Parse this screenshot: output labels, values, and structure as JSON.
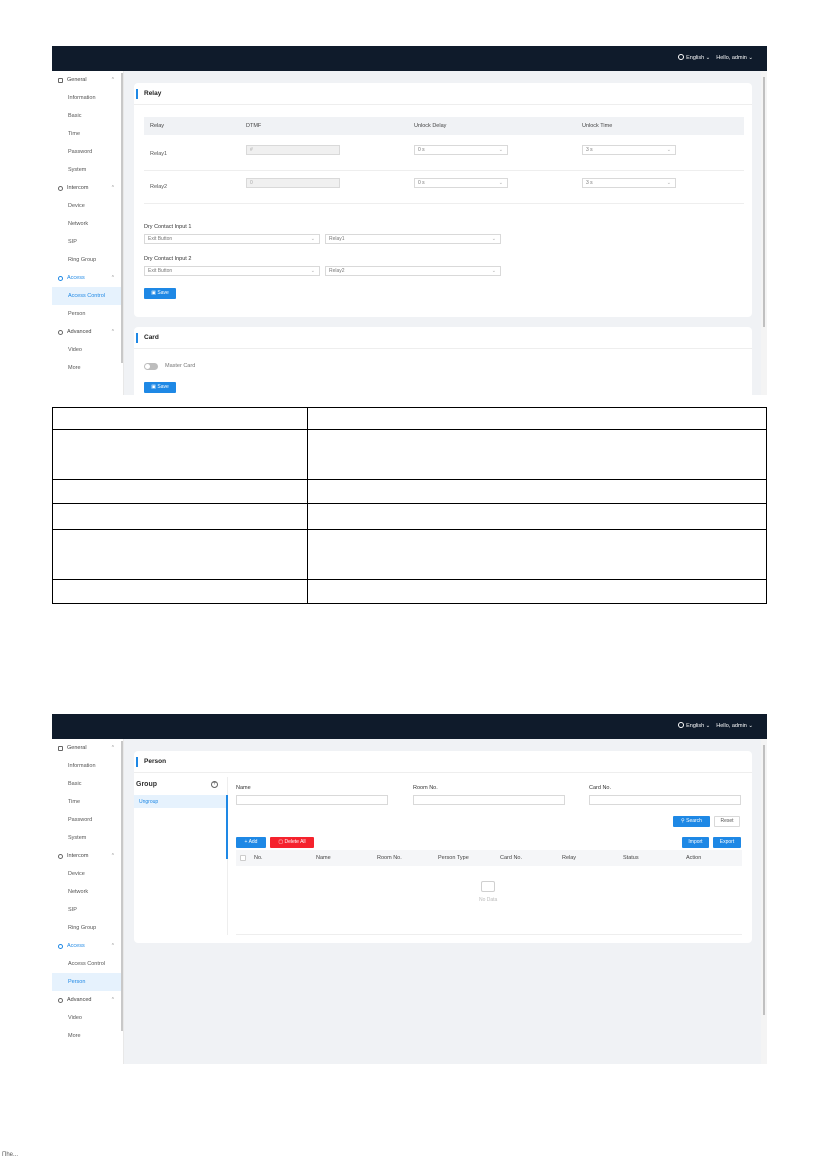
{
  "topbar": {
    "language": "English",
    "greeting": "Hello, admin"
  },
  "sidebar": {
    "general": "General",
    "general_items": [
      "Information",
      "Basic",
      "Time",
      "Password",
      "System"
    ],
    "intercom": "Intercom",
    "intercom_items": [
      "Device",
      "Network",
      "SIP",
      "Ring Group"
    ],
    "access": "Access",
    "access_items": [
      "Access Control",
      "Person"
    ],
    "advanced": "Advanced",
    "advanced_items": [
      "Video",
      "More"
    ]
  },
  "relay_card": {
    "title": "Relay",
    "columns": [
      "Relay",
      "DTMF",
      "Unlock Delay",
      "Unlock Time"
    ],
    "rows": [
      {
        "relay": "Relay1",
        "dtmf": "#",
        "delay": "0 s",
        "time": "3 s"
      },
      {
        "relay": "Relay2",
        "dtmf": "0",
        "delay": "0 s",
        "time": "3 s"
      }
    ],
    "dry1_label": "Dry Contact Input 1",
    "dry1_source": "Exit Button",
    "dry1_relay": "Relay1",
    "dry2_label": "Dry Contact Input 2",
    "dry2_source": "Exit Button",
    "dry2_relay": "Relay2",
    "save": "Save"
  },
  "card_card": {
    "title": "Card",
    "master_card": "Master Card",
    "save": "Save"
  },
  "person_page": {
    "title": "Person",
    "group_title": "Group",
    "group_item": "Ungroup",
    "name_label": "Name",
    "room_label": "Room No.",
    "card_label": "Card No.",
    "search": "Search",
    "reset": "Reset",
    "add": "Add",
    "delete_all": "Delete All",
    "import": "Import",
    "export": "Export",
    "columns": [
      "No.",
      "Name",
      "Room No.",
      "Person Type",
      "Card No.",
      "Relay",
      "Status",
      "Action"
    ],
    "empty": "No Data"
  },
  "chevron": "⌃",
  "down": "⌄",
  "fleck": "Пhe..."
}
